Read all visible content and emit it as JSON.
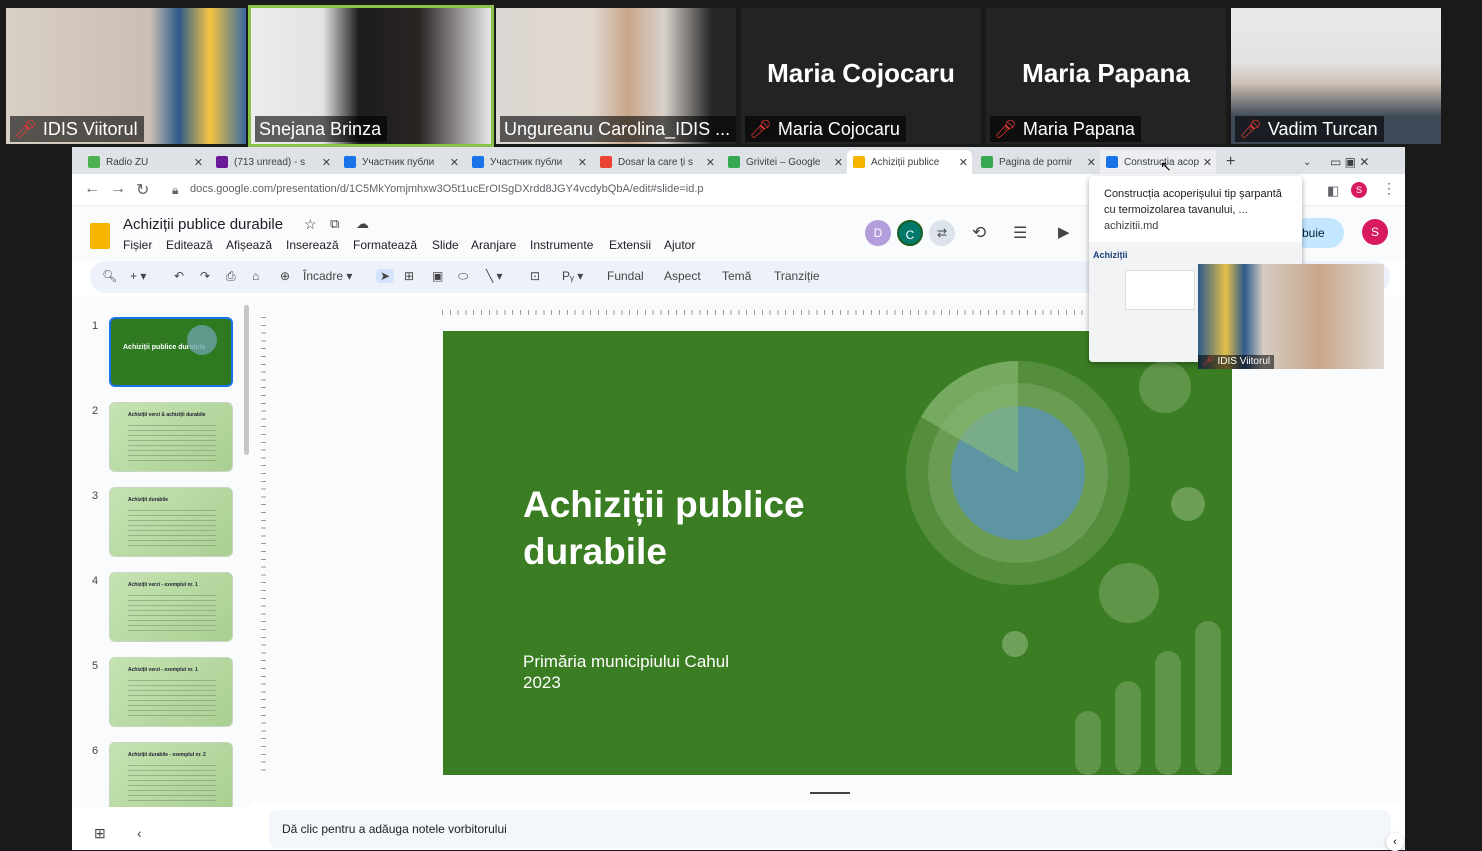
{
  "zoom": {
    "participants": [
      {
        "name": "IDIS Viitorul",
        "muted": true
      },
      {
        "name": "Snejana Brinza",
        "muted": false
      },
      {
        "name": "Ungureanu Carolina_IDIS ...",
        "muted": false
      },
      {
        "name": "Maria Cojocaru",
        "display": "Maria Cojocaru",
        "muted": true
      },
      {
        "name": "Maria Papana",
        "display": "Maria Papana",
        "muted": true
      },
      {
        "name": "Vadim Turcan",
        "muted": true
      }
    ]
  },
  "browser": {
    "tabs": [
      {
        "label": "Radio ZU",
        "color": "#4caf50"
      },
      {
        "label": "(713 unread) - s",
        "color": "#6a1b9a"
      },
      {
        "label": "Участник публи",
        "color": "#1a73e8"
      },
      {
        "label": "Участник публи",
        "color": "#1a73e8"
      },
      {
        "label": "Dosar la care ți s",
        "color": "#ea4335"
      },
      {
        "label": "Grivitei – Google",
        "color": "#34a853"
      },
      {
        "label": "Achiziții publice",
        "color": "#f6b400"
      },
      {
        "label": "Pagina de pornir",
        "color": "#34a853"
      },
      {
        "label": "Construcția acop",
        "color": "#1a73e8"
      }
    ],
    "url": "docs.google.com/presentation/d/1C5MkYomjmhxw3O5t1ucErOISgDXrdd8JGY4vcdybQbA/edit#slide=id.p"
  },
  "slides": {
    "doc_title": "Achiziții publice durabile",
    "menu": [
      "Fișier",
      "Editează",
      "Afișează",
      "Inserează",
      "Formatează",
      "Slide",
      "Aranjare",
      "Instrumente",
      "Extensii",
      "Ajutor"
    ],
    "toolbar": {
      "fit": "Încadre",
      "background": "Fundal",
      "aspect": "Aspect",
      "theme": "Temă",
      "transition": "Tranziție"
    },
    "avatars": [
      "D",
      "C",
      "S"
    ],
    "share_label": "buie",
    "thumbnails": [
      {
        "num": "1",
        "title": "Achiziții publice durabile"
      },
      {
        "num": "2",
        "title": "Achiziții verzi & achiziții durabile"
      },
      {
        "num": "3",
        "title": "Achiziții durabile"
      },
      {
        "num": "4",
        "title": "Achiziții verzi - exemplul nr. 1"
      },
      {
        "num": "5",
        "title": "Achiziții verzi - exemplul nr. 1"
      },
      {
        "num": "6",
        "title": "Achiziții durabile - exemplul nr. 2"
      }
    ],
    "slide_title": "Achiziții publice durabile",
    "slide_subtitle_1": "Primăria municipiului Cahul",
    "slide_subtitle_2": "2023",
    "notes_placeholder": "Dă clic pentru a adăuga notele vorbitorului"
  },
  "popup": {
    "title": "Construcția acoperișului tip șarpantă cu termoizolarea tavanului, ...",
    "domain": "achizitii.md",
    "mini_video_name": "IDIS Viitorul"
  }
}
